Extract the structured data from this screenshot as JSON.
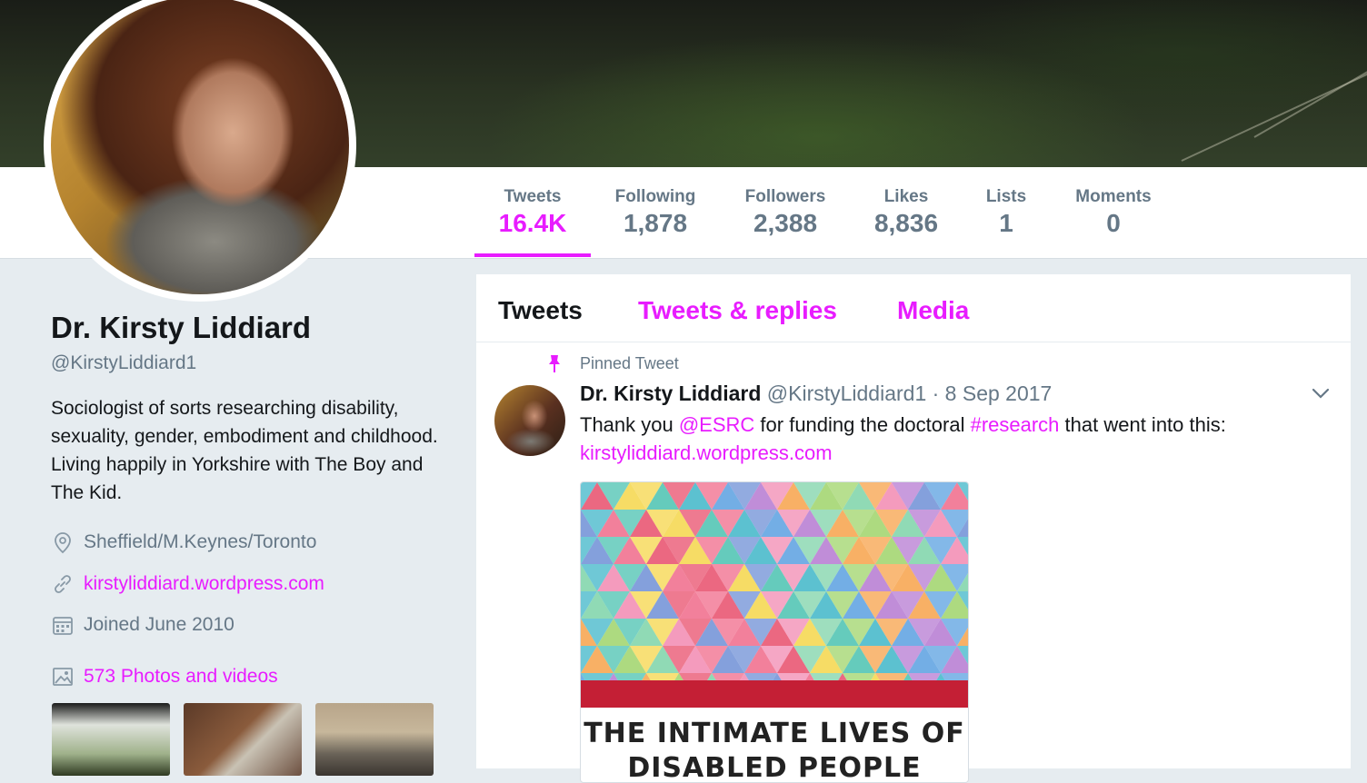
{
  "profile": {
    "name": "Dr. Kirsty Liddiard",
    "handle": "@KirstyLiddiard1",
    "bio": "Sociologist of sorts researching disability, sexuality, gender, embodiment and childhood. Living happily in Yorkshire with The Boy and The Kid.",
    "location": "Sheffield/M.Keynes/Toronto",
    "website": "kirstyliddiard.wordpress.com",
    "joined": "Joined June 2010",
    "media_link": "573 Photos and videos"
  },
  "stats": [
    {
      "label": "Tweets",
      "value": "16.4K"
    },
    {
      "label": "Following",
      "value": "1,878"
    },
    {
      "label": "Followers",
      "value": "2,388"
    },
    {
      "label": "Likes",
      "value": "8,836"
    },
    {
      "label": "Lists",
      "value": "1"
    },
    {
      "label": "Moments",
      "value": "0"
    }
  ],
  "tabs": [
    {
      "label": "Tweets"
    },
    {
      "label": "Tweets & replies"
    },
    {
      "label": "Media"
    }
  ],
  "pinned_tweet": {
    "pinned_label": "Pinned Tweet",
    "author": "Dr. Kirsty Liddiard",
    "meta": "@KirstyLiddiard1 · 8 Sep 2017",
    "text_1": "Thank you ",
    "mention": "@ESRC",
    "text_2": " for funding the doctoral ",
    "hashtag": "#research",
    "text_3": " that went into this:",
    "link": "kirstyliddiard.wordpress.com",
    "card_title_1": "THE INTIMATE LIVES OF",
    "card_title_2": "DISABLED PEOPLE"
  },
  "colors": {
    "accent": "#e81cff",
    "text_primary": "#14171a",
    "text_secondary": "#657786",
    "background": "#e6ecf0"
  },
  "icons": [
    "location-icon",
    "link-icon",
    "calendar-icon",
    "photo-icon",
    "pin-icon",
    "chevron-down-icon"
  ]
}
